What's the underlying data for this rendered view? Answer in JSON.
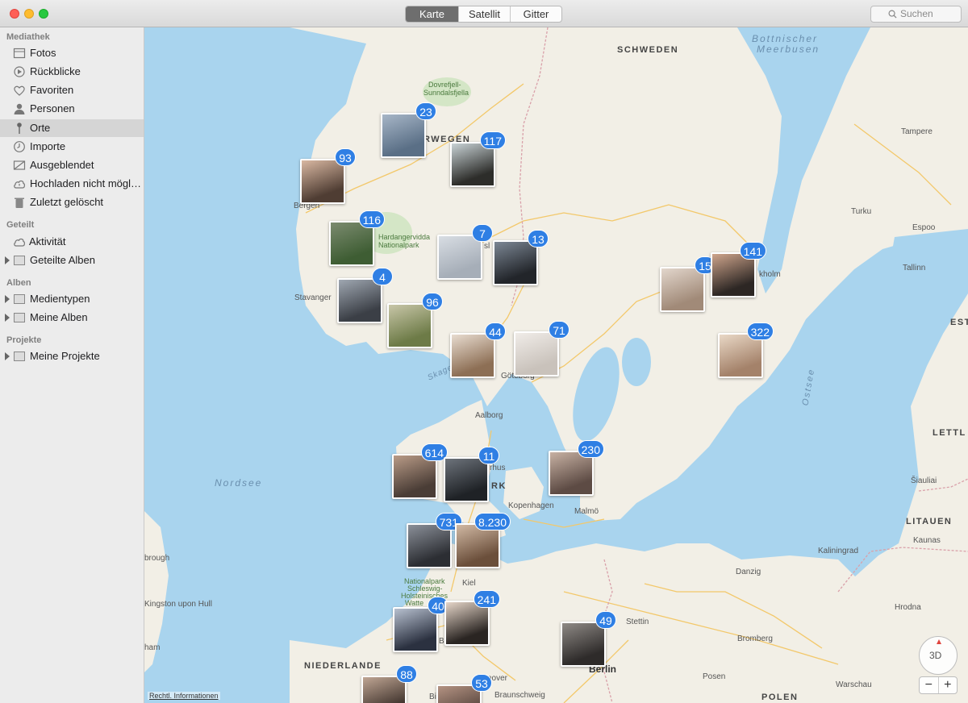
{
  "toolbar": {
    "segments": [
      {
        "label": "Karte",
        "active": true
      },
      {
        "label": "Satellit",
        "active": false
      },
      {
        "label": "Gitter",
        "active": false
      }
    ],
    "search_placeholder": "Suchen"
  },
  "sidebar": {
    "sections": [
      {
        "title": "Mediathek",
        "items": [
          {
            "label": "Fotos",
            "icon": "photos-icon"
          },
          {
            "label": "Rückblicke",
            "icon": "memories-icon"
          },
          {
            "label": "Favoriten",
            "icon": "heart-icon"
          },
          {
            "label": "Personen",
            "icon": "person-icon"
          },
          {
            "label": "Orte",
            "icon": "pin-icon",
            "selected": true
          },
          {
            "label": "Importe",
            "icon": "clock-icon"
          },
          {
            "label": "Ausgeblendet",
            "icon": "hidden-icon"
          },
          {
            "label": "Hochladen nicht mögl…",
            "icon": "cloud-warning-icon"
          },
          {
            "label": "Zuletzt gelöscht",
            "icon": "trash-icon"
          }
        ]
      },
      {
        "title": "Geteilt",
        "items": [
          {
            "label": "Aktivität",
            "icon": "cloud-icon"
          },
          {
            "label": "Geteilte Alben",
            "icon": "folder-icon",
            "disclosure": true
          }
        ]
      },
      {
        "title": "Alben",
        "items": [
          {
            "label": "Medientypen",
            "icon": "folder-icon",
            "disclosure": true
          },
          {
            "label": "Meine Alben",
            "icon": "folder-icon",
            "disclosure": true
          }
        ]
      },
      {
        "title": "Projekte",
        "items": [
          {
            "label": "Meine Projekte",
            "icon": "folder-icon",
            "disclosure": true
          }
        ]
      }
    ]
  },
  "map": {
    "labels": {
      "schweden": "SCHWEDEN",
      "norwegen": "RWEGEN",
      "bottnischer": "Bottnischer",
      "meerbusen": "Meerbusen",
      "dovre": "Dovrefjell-",
      "dovre2": "Sunndalsfjella",
      "hardanger": "Hardangervidda",
      "hardanger2": "Nationalpark",
      "bergen": "Bergen",
      "stavanger": "Stavanger",
      "skagerrak": "Skager",
      "goteborg": "Göteborg",
      "oslo": "sl",
      "stockholm": "kholm",
      "tampere": "Tampere",
      "turku": "Turku",
      "espoo": "Espoo",
      "tallinn": "Tallinn",
      "est": "EST",
      "ostsee": "Ostsee",
      "aalborg": "Aalborg",
      "aarhus": "rhus",
      "dk": "RK",
      "nordsee": "Nordsee",
      "kopenhagen": "Kopenhagen",
      "malmo": "Malmö",
      "lettland": "LETTL",
      "siauliai": "Šiauliai",
      "litauen": "LITAUEN",
      "kaunas": "Kaunas",
      "kaliningrad": "Kaliningrad",
      "danzig": "Danzig",
      "kiel": "Kiel",
      "np1": "Nationalpark",
      "np2": "Schleswig-",
      "np3": "Holsteinisches",
      "np4": "Watte",
      "stettin": "Stettin",
      "hrodna": "Hrodna",
      "bromberg": "Bromberg",
      "posen": "Posen",
      "warschau": "Warschau",
      "polen": "POLEN",
      "berlin": "Berlin",
      "niederlande": "NIEDERLANDE",
      "braunschweig": "Braunschweig",
      "hannover": "nover",
      "kingston": "Kingston upon Hull",
      "scarborough": "brough",
      "hull2": "ham",
      "bi": "Bi",
      "b": "B"
    },
    "clusters": [
      {
        "count": "23",
        "colors": [
          "#5a6f86",
          "#a7b6c7"
        ]
      },
      {
        "count": "117",
        "colors": [
          "#2d2d2a",
          "#c9d3d6"
        ]
      },
      {
        "count": "93",
        "colors": [
          "#4f3d33",
          "#d9b8a2"
        ]
      },
      {
        "count": "116",
        "colors": [
          "#3e5d33",
          "#7b8b6f"
        ]
      },
      {
        "count": "7",
        "colors": [
          "#a6aeb8",
          "#d8dde3"
        ]
      },
      {
        "count": "13",
        "colors": [
          "#22252a",
          "#7c8794"
        ]
      },
      {
        "count": "4",
        "colors": [
          "#3b3f46",
          "#9fa7b1"
        ]
      },
      {
        "count": "96",
        "colors": [
          "#6d7b47",
          "#c8c6a8"
        ]
      },
      {
        "count": "15",
        "colors": [
          "#a18a78",
          "#e2d6cc"
        ]
      },
      {
        "count": "141",
        "colors": [
          "#2d2724",
          "#cfa58c"
        ]
      },
      {
        "count": "44",
        "colors": [
          "#8d6f55",
          "#e8dcd0"
        ]
      },
      {
        "count": "71",
        "colors": [
          "#c9c2bb",
          "#f0ece8"
        ]
      },
      {
        "count": "322",
        "colors": [
          "#a4826a",
          "#e9d8c6"
        ]
      },
      {
        "count": "614",
        "colors": [
          "#4a3d36",
          "#b99b87"
        ]
      },
      {
        "count": "11",
        "colors": [
          "#1f2226",
          "#6d737b"
        ]
      },
      {
        "count": "230",
        "colors": [
          "#5d4b44",
          "#c7b1a3"
        ]
      },
      {
        "count": "731",
        "colors": [
          "#2c2e33",
          "#8b9099"
        ]
      },
      {
        "count": "8.230",
        "colors": [
          "#6b4f3b",
          "#d1b9a4"
        ]
      },
      {
        "count": "40",
        "colors": [
          "#2b3140",
          "#b7c0cf"
        ]
      },
      {
        "count": "241",
        "colors": [
          "#2a2522",
          "#e6d6c9"
        ]
      },
      {
        "count": "49",
        "colors": [
          "#2e2b2a",
          "#8f8a86"
        ]
      },
      {
        "count": "88",
        "colors": [
          "#3a2e28",
          "#c0a694"
        ]
      },
      {
        "count": "53",
        "colors": [
          "#4a3a33",
          "#b49383"
        ]
      }
    ],
    "legal_text": "Rechtl. Informationen",
    "compass_label": "3D",
    "zoom_out": "−",
    "zoom_in": "+"
  }
}
